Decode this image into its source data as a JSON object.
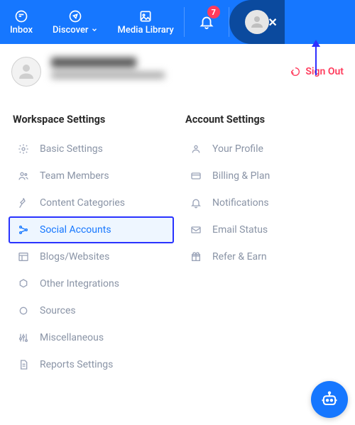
{
  "nav": {
    "inbox": "Inbox",
    "discover": "Discover",
    "media": "Media Library",
    "badge": "7"
  },
  "signout": "Sign Out",
  "workspace": {
    "heading": "Workspace Settings",
    "items": [
      {
        "label": "Basic Settings"
      },
      {
        "label": "Team Members"
      },
      {
        "label": "Content Categories"
      },
      {
        "label": "Social Accounts"
      },
      {
        "label": "Blogs/Websites"
      },
      {
        "label": "Other Integrations"
      },
      {
        "label": "Sources"
      },
      {
        "label": "Miscellaneous"
      },
      {
        "label": "Reports Settings"
      }
    ]
  },
  "account": {
    "heading": "Account Settings",
    "items": [
      {
        "label": "Your Profile"
      },
      {
        "label": "Billing & Plan"
      },
      {
        "label": "Notifications"
      },
      {
        "label": "Email Status"
      },
      {
        "label": "Refer & Earn"
      }
    ]
  }
}
